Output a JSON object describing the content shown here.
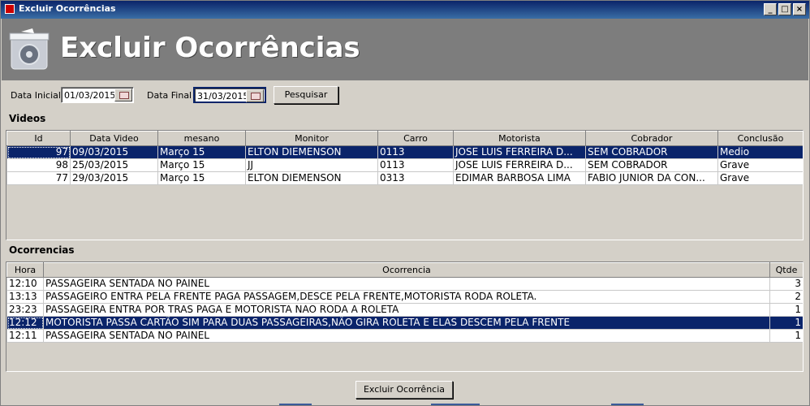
{
  "window": {
    "title": "Excluir Ocorrências",
    "controls": {
      "minimize": "_",
      "maximize": "□",
      "close": "×"
    }
  },
  "header": {
    "title": "Excluir Ocorrências",
    "icon": "trash-disc-icon"
  },
  "filters": {
    "start_label": "Data Inicial",
    "start_value": "01/03/2015",
    "end_label": "Data Final",
    "end_value": "31/03/2015",
    "search_label": "Pesquisar"
  },
  "videos": {
    "section_label": "Videos",
    "columns": [
      "Id",
      "Data Video",
      "mesano",
      "Monitor",
      "Carro",
      "Motorista",
      "Cobrador",
      "Conclusão"
    ],
    "rows": [
      {
        "id": "97",
        "data": "09/03/2015",
        "mesano": "Março 15",
        "monitor": "ELTON DIEMENSON",
        "carro": "0113",
        "motorista": "JOSE LUIS FERREIRA D...",
        "cobrador": "SEM COBRADOR",
        "conclusao": "Medio",
        "selected": true
      },
      {
        "id": "98",
        "data": "25/03/2015",
        "mesano": "Março 15",
        "monitor": "JJ",
        "carro": "0113",
        "motorista": "JOSE LUIS FERREIRA D...",
        "cobrador": "SEM COBRADOR",
        "conclusao": "Grave",
        "selected": false
      },
      {
        "id": "77",
        "data": "29/03/2015",
        "mesano": "Março 15",
        "monitor": "ELTON DIEMENSON",
        "carro": "0313",
        "motorista": "EDIMAR BARBOSA LIMA",
        "cobrador": "FABIO JUNIOR DA CON...",
        "conclusao": "Grave",
        "selected": false
      }
    ]
  },
  "ocorrencias": {
    "section_label": "Ocorrencias",
    "columns": [
      "Hora",
      "Ocorrencia",
      "Qtde"
    ],
    "rows": [
      {
        "hora": "12:10",
        "ocorrencia": "PASSAGEIRA SENTADA NO PAINEL",
        "qtde": "3",
        "selected": false
      },
      {
        "hora": "13:13",
        "ocorrencia": "PASSAGEIRO ENTRA PELA FRENTE PAGA PASSAGEM,DESCE PELA FRENTE,MOTORISTA RODA ROLETA.",
        "qtde": "2",
        "selected": false
      },
      {
        "hora": "23:23",
        "ocorrencia": "PASSAGEIRA ENTRA POR TRAS PAGA E MOTORISTA NAO RODA A ROLETA",
        "qtde": "1",
        "selected": false
      },
      {
        "hora": "12:12",
        "ocorrencia": "MOTORISTA PASSA CARTÃO SIM PARA DUAS PASSAGEIRAS,NÃO GIRA ROLETA E ELAS DESCEM PELA FRENTE",
        "qtde": "1",
        "selected": true
      },
      {
        "hora": "12:11",
        "ocorrencia": "PASSAGEIRA SENTADA NO PAINEL",
        "qtde": "1",
        "selected": false
      }
    ]
  },
  "actions": {
    "delete_label": "Excluir Ocorrência"
  }
}
